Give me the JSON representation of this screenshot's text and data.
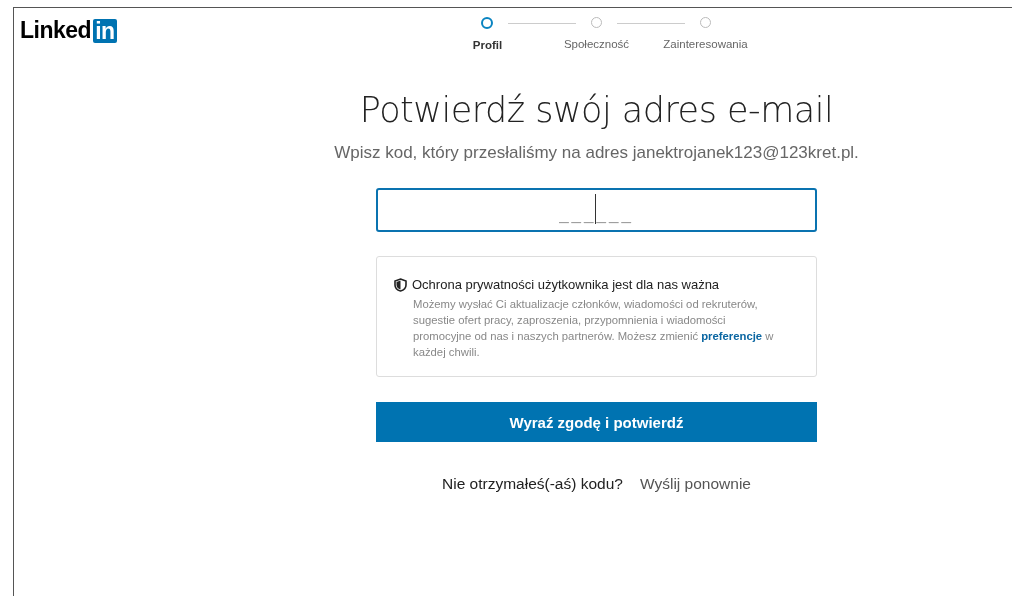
{
  "logo": {
    "text": "Linked",
    "badge": "in"
  },
  "steps": [
    {
      "label": "Profil",
      "selected": true
    },
    {
      "label": "Społeczność",
      "selected": false
    },
    {
      "label": "Zainteresowania",
      "selected": false
    }
  ],
  "heading": "Potwierdź swój adres e-mail",
  "subtitle": "Wpisz kod, który przesłaliśmy na adres janektrojanek123@123kret.pl.",
  "code_field": {
    "placeholder": "______"
  },
  "privacy": {
    "title": "Ochrona prywatności użytkownika jest dla nas ważna",
    "text": "Możemy wysłać Ci aktualizacje członków, wiadomości od rekruterów, sugestie ofert pracy, zaproszenia, przypomnienia i wiadomości promocyjne od nas i naszych partnerów. Możesz zmienić",
    "link": "preferencje",
    "text_end": "w każdej chwili."
  },
  "button": "Wyraź zgodę i potwierdź",
  "resend": {
    "question": "Nie otrzymałeś(-aś) kodu?",
    "link": "Wyślij ponownie"
  }
}
